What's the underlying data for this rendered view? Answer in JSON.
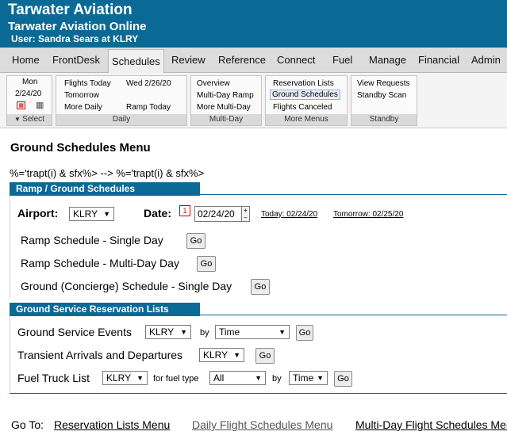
{
  "header": {
    "company": "Tarwater Aviation",
    "app": "Tarwater Aviation Online",
    "user": "User:  Sandra Sears at KLRY"
  },
  "nav": [
    "Home",
    "FrontDesk",
    "Schedules",
    "Review",
    "Reference",
    "Connect",
    "Fuel",
    "Manage",
    "Financial",
    "Admin"
  ],
  "nav_active": "Schedules",
  "ribbon": {
    "select": {
      "day": "Mon",
      "date": "2/24/20",
      "title": "Select"
    },
    "daily": {
      "l1": "Flights Today",
      "l2": "Wed 2/26/20",
      "l3": "Tomorrow",
      "l4": "More Daily",
      "l5": "Ramp Today",
      "title": "Daily"
    },
    "multiday": {
      "l1": "Overview",
      "l2": "Multi-Day Ramp",
      "l3": "More Multi-Day",
      "title": "Multi-Day"
    },
    "menus": {
      "l1": "Reservation Lists",
      "l2": "Ground Schedules",
      "l3": "Flights Canceled",
      "title": "More Menus"
    },
    "standby": {
      "l1": "View Requests",
      "l2": "Standby Scan",
      "title": "Standby"
    }
  },
  "page_title": "Ground Schedules Menu",
  "junk_text": "%='trapt(i) & sfx%> --> %='trapt(i) & sfx%>",
  "ramp": {
    "title": "Ramp / Ground Schedules",
    "airport_label": "Airport:",
    "airport_value": "KLRY",
    "date_label": "Date:",
    "date_value": "02/24/20",
    "today_link": "Today: 02/24/20",
    "tomorrow_link": "Tomorrow: 02/25/20",
    "rows": [
      "Ramp Schedule - Single Day",
      "Ramp Schedule - Multi-Day Day",
      "Ground (Concierge) Schedule - Single Day"
    ],
    "go": "Go"
  },
  "ground": {
    "title": "Ground Service Reservation Lists",
    "r1_label": "Ground Service Events",
    "r1_airport": "KLRY",
    "by": "by",
    "r1_sort": "Time",
    "r2_label": "Transient Arrivals and Departures",
    "r2_airport": "KLRY",
    "r3_label": "Fuel Truck List",
    "r3_airport": "KLRY",
    "fuel_type_label": "for fuel type",
    "fuel_type": "All",
    "r3_sort": "Time",
    "go": "Go"
  },
  "goto": {
    "label": "Go To:",
    "l1": "Reservation Lists Menu",
    "l2": "Daily Flight Schedules Menu",
    "l3": "Multi-Day Flight Schedules Menu"
  },
  "colors": {
    "brand": "#0b6a95",
    "nav_bg": "#dcdcdc"
  }
}
